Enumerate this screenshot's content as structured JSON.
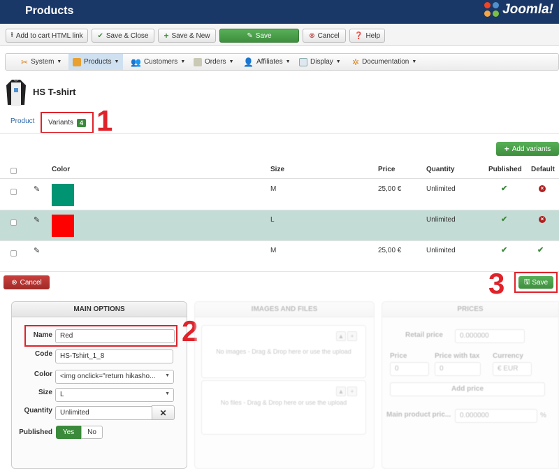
{
  "header": {
    "title": "Products",
    "brand": "Joomla!"
  },
  "toolbar": {
    "add_to_cart": "Add to cart HTML link",
    "save_close": "Save & Close",
    "save_new": "Save & New",
    "save": "Save",
    "cancel": "Cancel",
    "help": "Help"
  },
  "menu": {
    "items": [
      "System",
      "Products",
      "Customers",
      "Orders",
      "Affiliates",
      "Display",
      "Documentation"
    ],
    "active": "Products"
  },
  "product": {
    "name": "HS T-shirt"
  },
  "tabs": {
    "product": "Product",
    "variants": "Variants",
    "variants_count": "4"
  },
  "annotations": {
    "one": "1",
    "two": "2",
    "three": "3"
  },
  "variants_table": {
    "add_button": "Add variants",
    "columns": {
      "color": "Color",
      "size": "Size",
      "price": "Price",
      "quantity": "Quantity",
      "published": "Published",
      "default": "Default"
    },
    "rows": [
      {
        "color_hex": "#009473",
        "size": "M",
        "price": "25,00 €",
        "quantity": "Unlimited",
        "published": "yes",
        "default": "no"
      },
      {
        "color_hex": "#ff0000",
        "size": "L",
        "price": "",
        "quantity": "Unlimited",
        "published": "yes",
        "default": "no"
      },
      {
        "color_hex": "#ffffff",
        "size": "M",
        "price": "25,00 €",
        "quantity": "Unlimited",
        "published": "yes",
        "default": "yes"
      }
    ]
  },
  "actions": {
    "cancel": "Cancel",
    "save": "Save"
  },
  "main_options": {
    "title": "MAIN OPTIONS",
    "name_label": "Name",
    "name_value": "Red",
    "code_label": "Code",
    "code_value": "HS-Tshirt_1_8",
    "color_label": "Color",
    "color_value": "<img onclick=\"return hikasho...",
    "size_label": "Size",
    "size_value": "L",
    "quantity_label": "Quantity",
    "quantity_value": "Unlimited",
    "published_label": "Published",
    "yes": "Yes",
    "no": "No"
  },
  "images_files": {
    "title": "IMAGES AND FILES",
    "images_text": "No images - Drag & Drop here or use the upload",
    "files_text": "No files - Drag & Drop here or use the upload"
  },
  "prices": {
    "title": "PRICES",
    "retail_label": "Retail price",
    "retail_value": "0.000000",
    "price_label": "Price",
    "price_with_tax_label": "Price with tax",
    "currency_label": "Currency",
    "price_value": "0",
    "price_with_tax_value": "0",
    "currency_value": "€ EUR",
    "add_price": "Add price",
    "main_product_label": "Main product pric...",
    "main_product_value": "0.000000",
    "percent": "%"
  },
  "colors": {
    "header_bg": "#1a3867",
    "accent_green": "#3e8e3e",
    "danger": "#a12a28",
    "highlight_red": "#e0222a",
    "selected_row": "#c4dcd6"
  }
}
